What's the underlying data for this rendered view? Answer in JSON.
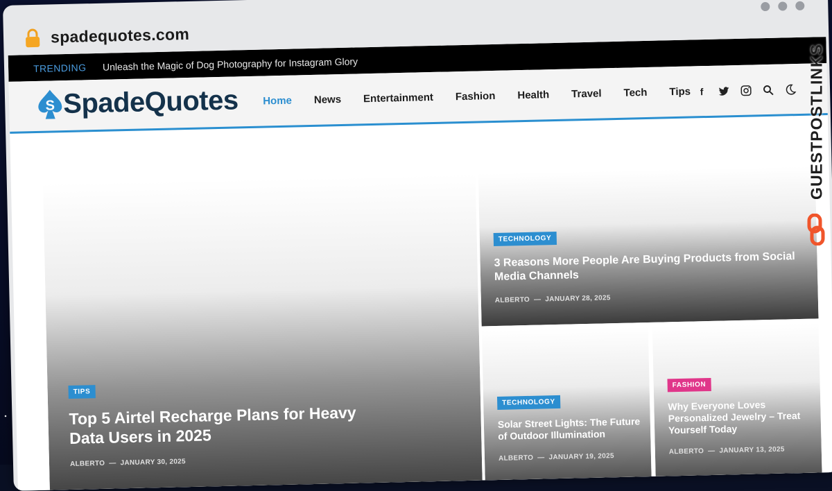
{
  "browser": {
    "url": "spadequotes.com"
  },
  "topbar": {
    "trending_label": "TRENDING",
    "trending_headline": "Unleash the Magic of Dog Photography for Instagram Glory"
  },
  "header": {
    "logo_text": "SpadeQuotes",
    "nav": [
      {
        "label": "Home",
        "active": true
      },
      {
        "label": "News"
      },
      {
        "label": "Entertainment"
      },
      {
        "label": "Fashion"
      },
      {
        "label": "Health"
      },
      {
        "label": "Travel"
      },
      {
        "label": "Tech"
      },
      {
        "label": "Tips"
      }
    ],
    "icons": [
      "facebook-icon",
      "twitter-icon",
      "instagram-icon",
      "search-icon",
      "dark-mode-icon"
    ]
  },
  "posts": [
    {
      "category": "TIPS",
      "category_color": "#2c8ed0",
      "title": "Top 5 Airtel Recharge Plans for Heavy Data Users in 2025",
      "author": "ALBERTO",
      "date": "JANUARY 30, 2025"
    },
    {
      "category": "TECHNOLOGY",
      "category_color": "#2c8ed0",
      "title": "3 Reasons More People Are Buying Products from Social Media Channels",
      "author": "ALBERTO",
      "date": "JANUARY 28, 2025"
    },
    {
      "category": "TECHNOLOGY",
      "category_color": "#2c8ed0",
      "title": "Solar Street Lights: The Future of Outdoor Illumination",
      "author": "ALBERTO",
      "date": "JANUARY 19, 2025"
    },
    {
      "category": "FASHION",
      "category_color": "#e0368a",
      "title": "Why Everyone Loves Personalized Jewelry – Treat Yourself Today",
      "author": "ALBERTO",
      "date": "JANUARY 13, 2025"
    }
  ],
  "watermark": {
    "text": "GUESTPOSTLINKS"
  }
}
